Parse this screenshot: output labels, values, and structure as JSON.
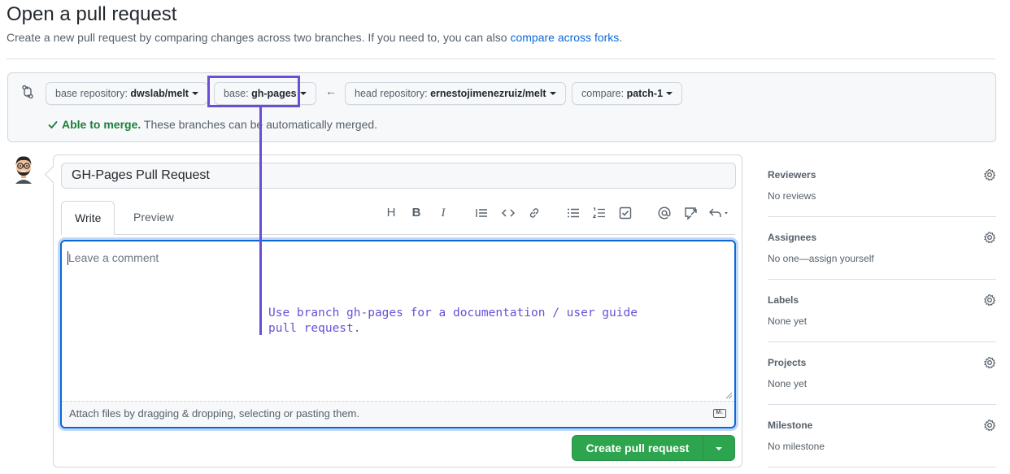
{
  "page": {
    "title": "Open a pull request",
    "subtitle_prefix": "Create a new pull request by comparing changes across two branches. If you need to, you can also ",
    "subtitle_link": "compare across forks",
    "subtitle_suffix": "."
  },
  "compare": {
    "base_repo_label": "base repository: ",
    "base_repo_value": "dwslab/melt",
    "base_label": "base: ",
    "base_value": "gh-pages",
    "arrow": "←",
    "head_repo_label": "head repository: ",
    "head_repo_value": "ernestojimenezruiz/melt",
    "compare_label": "compare: ",
    "compare_value": "patch-1",
    "merge_ok": "Able to merge.",
    "merge_text": " These branches can be automatically merged."
  },
  "form": {
    "title_value": "GH-Pages Pull Request",
    "tab_write": "Write",
    "tab_preview": "Preview",
    "comment_placeholder": "Leave a comment",
    "attach_text": "Attach files by dragging & dropping, selecting or pasting them.",
    "markdown_badge": "M↓",
    "create_button": "Create pull request"
  },
  "annotation": {
    "line1": "Use branch gh-pages for a documentation / user guide",
    "line2": "pull request."
  },
  "sidebar": {
    "sections": [
      {
        "title": "Reviewers",
        "value": "No reviews"
      },
      {
        "title": "Assignees",
        "value": "No one—assign yourself"
      },
      {
        "title": "Labels",
        "value": "None yet"
      },
      {
        "title": "Projects",
        "value": "None yet"
      },
      {
        "title": "Milestone",
        "value": "No milestone"
      }
    ]
  },
  "colors": {
    "link": "#0969da",
    "success": "#1a7f37",
    "primary_button": "#2da44e",
    "annotation": "#6a4fd6"
  },
  "toolbar_icons": [
    "heading-icon",
    "bold-icon",
    "italic-icon",
    "quote-icon",
    "code-icon",
    "link-icon",
    "bulleted-list-icon",
    "numbered-list-icon",
    "task-list-icon",
    "mention-icon",
    "reference-icon",
    "reply-icon"
  ]
}
